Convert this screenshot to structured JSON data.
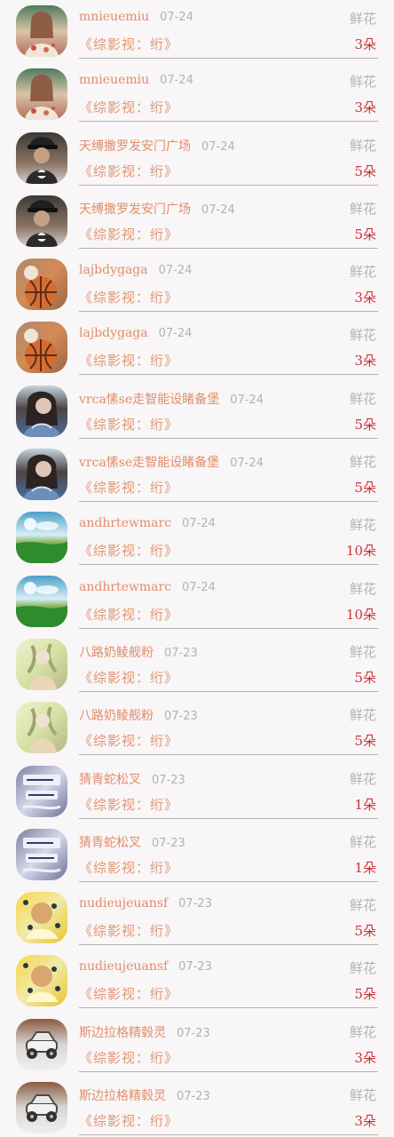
{
  "rows": [
    {
      "name": "mnieuemiu",
      "date": "07-24",
      "type": "鲜花",
      "work": "《综影视：绗》",
      "count": "3朵",
      "avatar": "avatar-woman-floral-icon"
    },
    {
      "name": "mnieuemiu",
      "date": "07-24",
      "type": "鲜花",
      "work": "《综影视：绗》",
      "count": "3朵",
      "avatar": "avatar-woman-floral-icon"
    },
    {
      "name": "天缚撒罗发安门广场",
      "date": "07-24",
      "type": "鲜花",
      "work": "《综影视：绗》",
      "count": "5朵",
      "avatar": "avatar-cap-person-icon"
    },
    {
      "name": "天缚撒罗发安门广场",
      "date": "07-24",
      "type": "鲜花",
      "work": "《综影视：绗》",
      "count": "5朵",
      "avatar": "avatar-cap-person-icon"
    },
    {
      "name": "lajbdygaga",
      "date": "07-24",
      "type": "鲜花",
      "work": "《综影视：绗》",
      "count": "3朵",
      "avatar": "avatar-basketball-icon"
    },
    {
      "name": "lajbdygaga",
      "date": "07-24",
      "type": "鲜花",
      "work": "《综影视：绗》",
      "count": "3朵",
      "avatar": "avatar-basketball-icon"
    },
    {
      "name": "vrca愫se走智能设睹备堡",
      "date": "07-24",
      "type": "鲜花",
      "work": "《综影视：绗》",
      "count": "5朵",
      "avatar": "avatar-woman-denim-icon"
    },
    {
      "name": "vrca愫se走智能设睹备堡",
      "date": "07-24",
      "type": "鲜花",
      "work": "《综影视：绗》",
      "count": "5朵",
      "avatar": "avatar-woman-denim-icon"
    },
    {
      "name": "andhrtewmarc",
      "date": "07-24",
      "type": "鲜花",
      "work": "《综影视：绗》",
      "count": "10朵",
      "avatar": "avatar-landscape-icon"
    },
    {
      "name": "andhrtewmarc",
      "date": "07-24",
      "type": "鲜花",
      "work": "《综影视：绗》",
      "count": "10朵",
      "avatar": "avatar-landscape-icon"
    },
    {
      "name": "八路奶鲮舰粉",
      "date": "07-23",
      "type": "鲜花",
      "work": "《综影视：绗》",
      "count": "5朵",
      "avatar": "avatar-illustration-icon"
    },
    {
      "name": "八路奶鲮舰粉",
      "date": "07-23",
      "type": "鲜花",
      "work": "《综影视：绗》",
      "count": "5朵",
      "avatar": "avatar-illustration-icon"
    },
    {
      "name": "猜青蛇松叉",
      "date": "07-23",
      "type": "鲜花",
      "work": "《综影视：绗》",
      "count": "1朵",
      "avatar": "avatar-text-note-icon"
    },
    {
      "name": "猜青蛇松叉",
      "date": "07-23",
      "type": "鲜花",
      "work": "《综影视：绗》",
      "count": "1朵",
      "avatar": "avatar-text-note-icon"
    },
    {
      "name": "nudieujeuansf",
      "date": "07-23",
      "type": "鲜花",
      "work": "《综影视：绗》",
      "count": "5朵",
      "avatar": "avatar-yellow-pattern-icon"
    },
    {
      "name": "nudieujeuansf",
      "date": "07-23",
      "type": "鲜花",
      "work": "《综影视：绗》",
      "count": "5朵",
      "avatar": "avatar-yellow-pattern-icon"
    },
    {
      "name": "斯边拉格精毂灵",
      "date": "07-23",
      "type": "鲜花",
      "work": "《综影视：绗》",
      "count": "3朵",
      "avatar": "avatar-toy-car-icon"
    },
    {
      "name": "斯边拉格精毂灵",
      "date": "07-23",
      "type": "鲜花",
      "work": "《综影视：绗》",
      "count": "3朵",
      "avatar": "avatar-toy-car-icon"
    }
  ],
  "colors": {
    "name": "#e18d6c",
    "date": "#b2b2b2",
    "work": "#e39474",
    "count": "#c8353b",
    "divider": "#b7b3b3"
  }
}
